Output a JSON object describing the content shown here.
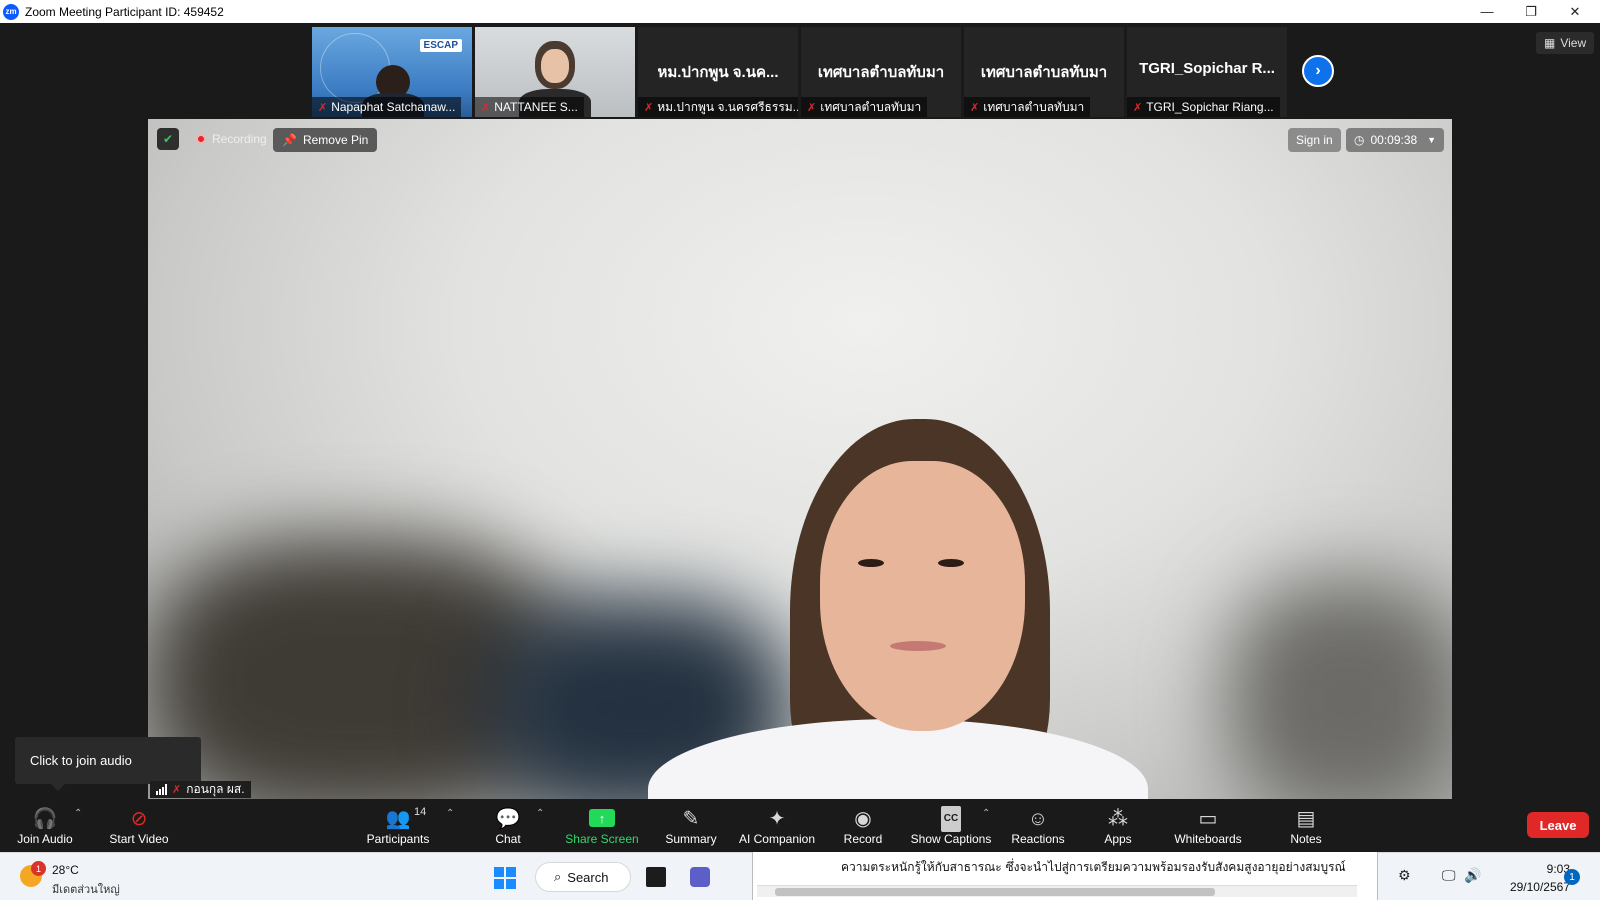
{
  "window": {
    "title": "Zoom Meeting Participant ID: 459452",
    "logo_text": "zm",
    "minimize": "—",
    "restore": "❐",
    "close": "✕"
  },
  "thumbnails": [
    {
      "name": "Napaphat Satchanaw...",
      "kind": "video",
      "org_logo": "ESCAP"
    },
    {
      "name": "NATTANEE S...",
      "kind": "video"
    },
    {
      "title": "หม.ปากพูน จ.นค...",
      "name": "หม.ปากพูน จ.นครศรีธรรม..."
    },
    {
      "title": "เทศบาลตำบลทับมา",
      "name": "เทศบาลตำบลทับมา"
    },
    {
      "title": "เทศบาลตำบลทับมา",
      "name": "เทศบาลตำบลทับมา"
    },
    {
      "title": "TGRI_Sopichar R...",
      "name": "TGRI_Sopichar Riang..."
    }
  ],
  "next_icon": "›",
  "view": {
    "icon": "▦",
    "label": "View"
  },
  "meeting": {
    "recording_label": "Recording",
    "remove_pin_label": "Remove Pin",
    "sign_in_label": "Sign in",
    "timer": "00:09:38"
  },
  "tooltip": "Click to join audio",
  "self_name": "กอนกุล ผส.",
  "toolbar": {
    "join_audio": "Join Audio",
    "start_video": "Start Video",
    "participants": "Participants",
    "participants_count": "14",
    "chat": "Chat",
    "share_screen": "Share Screen",
    "summary": "Summary",
    "ai_companion": "AI Companion",
    "record": "Record",
    "show_captions": "Show Captions",
    "captions_icon_text": "CC",
    "reactions": "Reactions",
    "apps": "Apps",
    "whiteboards": "Whiteboards",
    "notes": "Notes",
    "leave": "Leave"
  },
  "taskbar": {
    "weather_temp": "28°C",
    "weather_desc": "มีเดตส่วนใหญ่",
    "weather_badge": "1",
    "search_label": "Search",
    "doc_text": "ความตระหนักรู้ให้กับสาธารณะ ซึ่งจะนำไปสู่การเตรียมความพร้อมรองรับสังคมสูงอายุอย่างสมบูรณ์",
    "time": "9:03",
    "date": "29/10/2567",
    "notif_count": "1"
  },
  "colors": {
    "zoom_blue": "#0e72ed",
    "share_green": "#23d959",
    "leave_red": "#e02828",
    "mic_off_red": "#e02828"
  }
}
